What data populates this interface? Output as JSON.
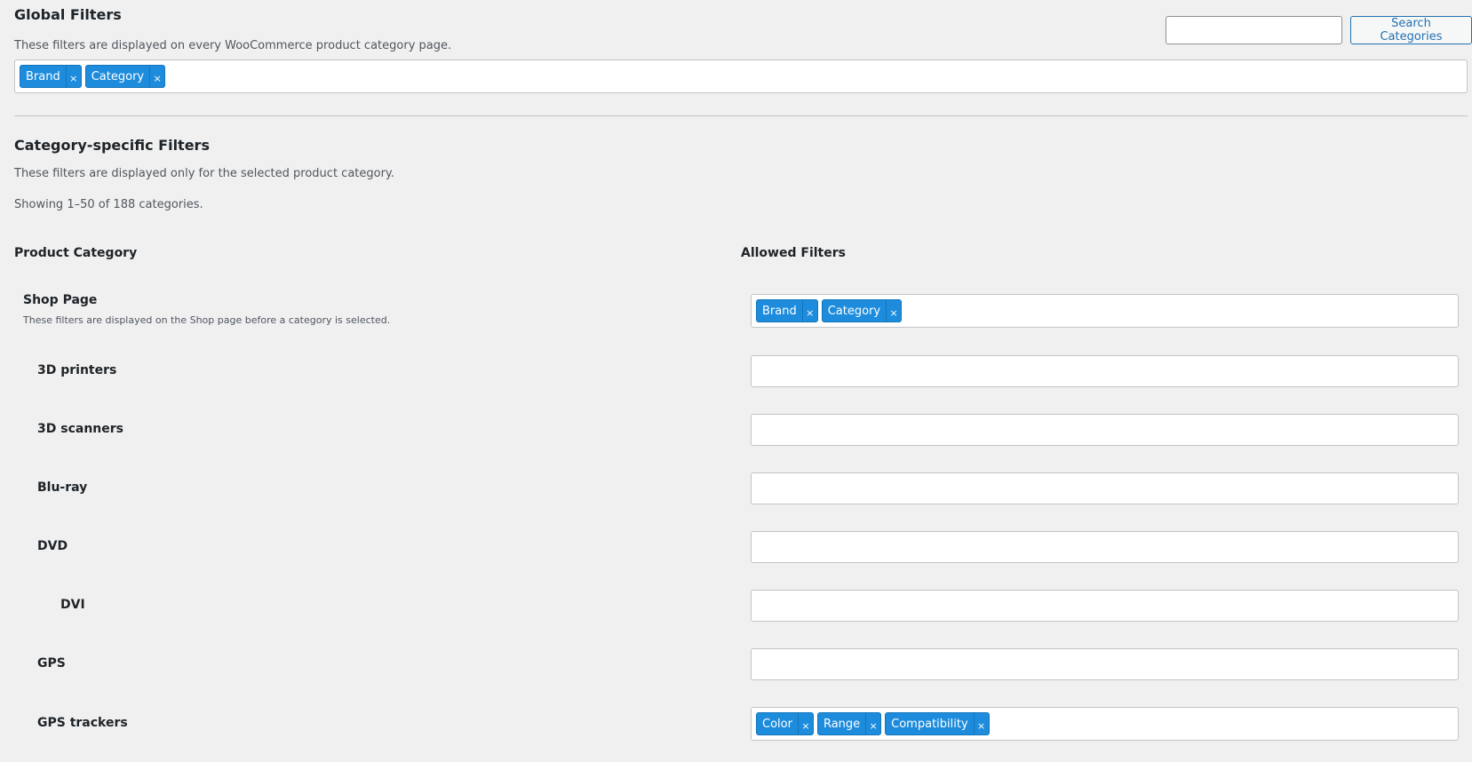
{
  "global": {
    "title": "Global Filters",
    "description": "These filters are displayed on every WooCommerce product category page.",
    "tags": [
      "Brand",
      "Category"
    ]
  },
  "search": {
    "value": "",
    "button_label": "Search Categories"
  },
  "category_section": {
    "title": "Category-specific Filters",
    "description": "These filters are displayed only for the selected product category.",
    "count_text": "Showing 1–50 of 188 categories.",
    "col_category": "Product Category",
    "col_filters": "Allowed Filters"
  },
  "shop_page": {
    "name": "Shop Page",
    "description": "These filters are displayed on the Shop page before a category is selected.",
    "tags": [
      "Brand",
      "Category"
    ]
  },
  "rows": [
    {
      "name": "3D printers",
      "tags": []
    },
    {
      "name": "3D scanners",
      "tags": []
    },
    {
      "name": "Blu-ray",
      "tags": []
    },
    {
      "name": "DVD",
      "tags": []
    },
    {
      "name": "DVI",
      "tags": []
    },
    {
      "name": "GPS",
      "tags": []
    },
    {
      "name": "GPS trackers",
      "tags": [
        "Color",
        "Range",
        "Compatibility"
      ]
    }
  ],
  "remove_glyph": "×",
  "colors": {
    "tag_bg": "#1e8cdc",
    "accent": "#2271b1",
    "page_bg": "#f0f0f1"
  }
}
